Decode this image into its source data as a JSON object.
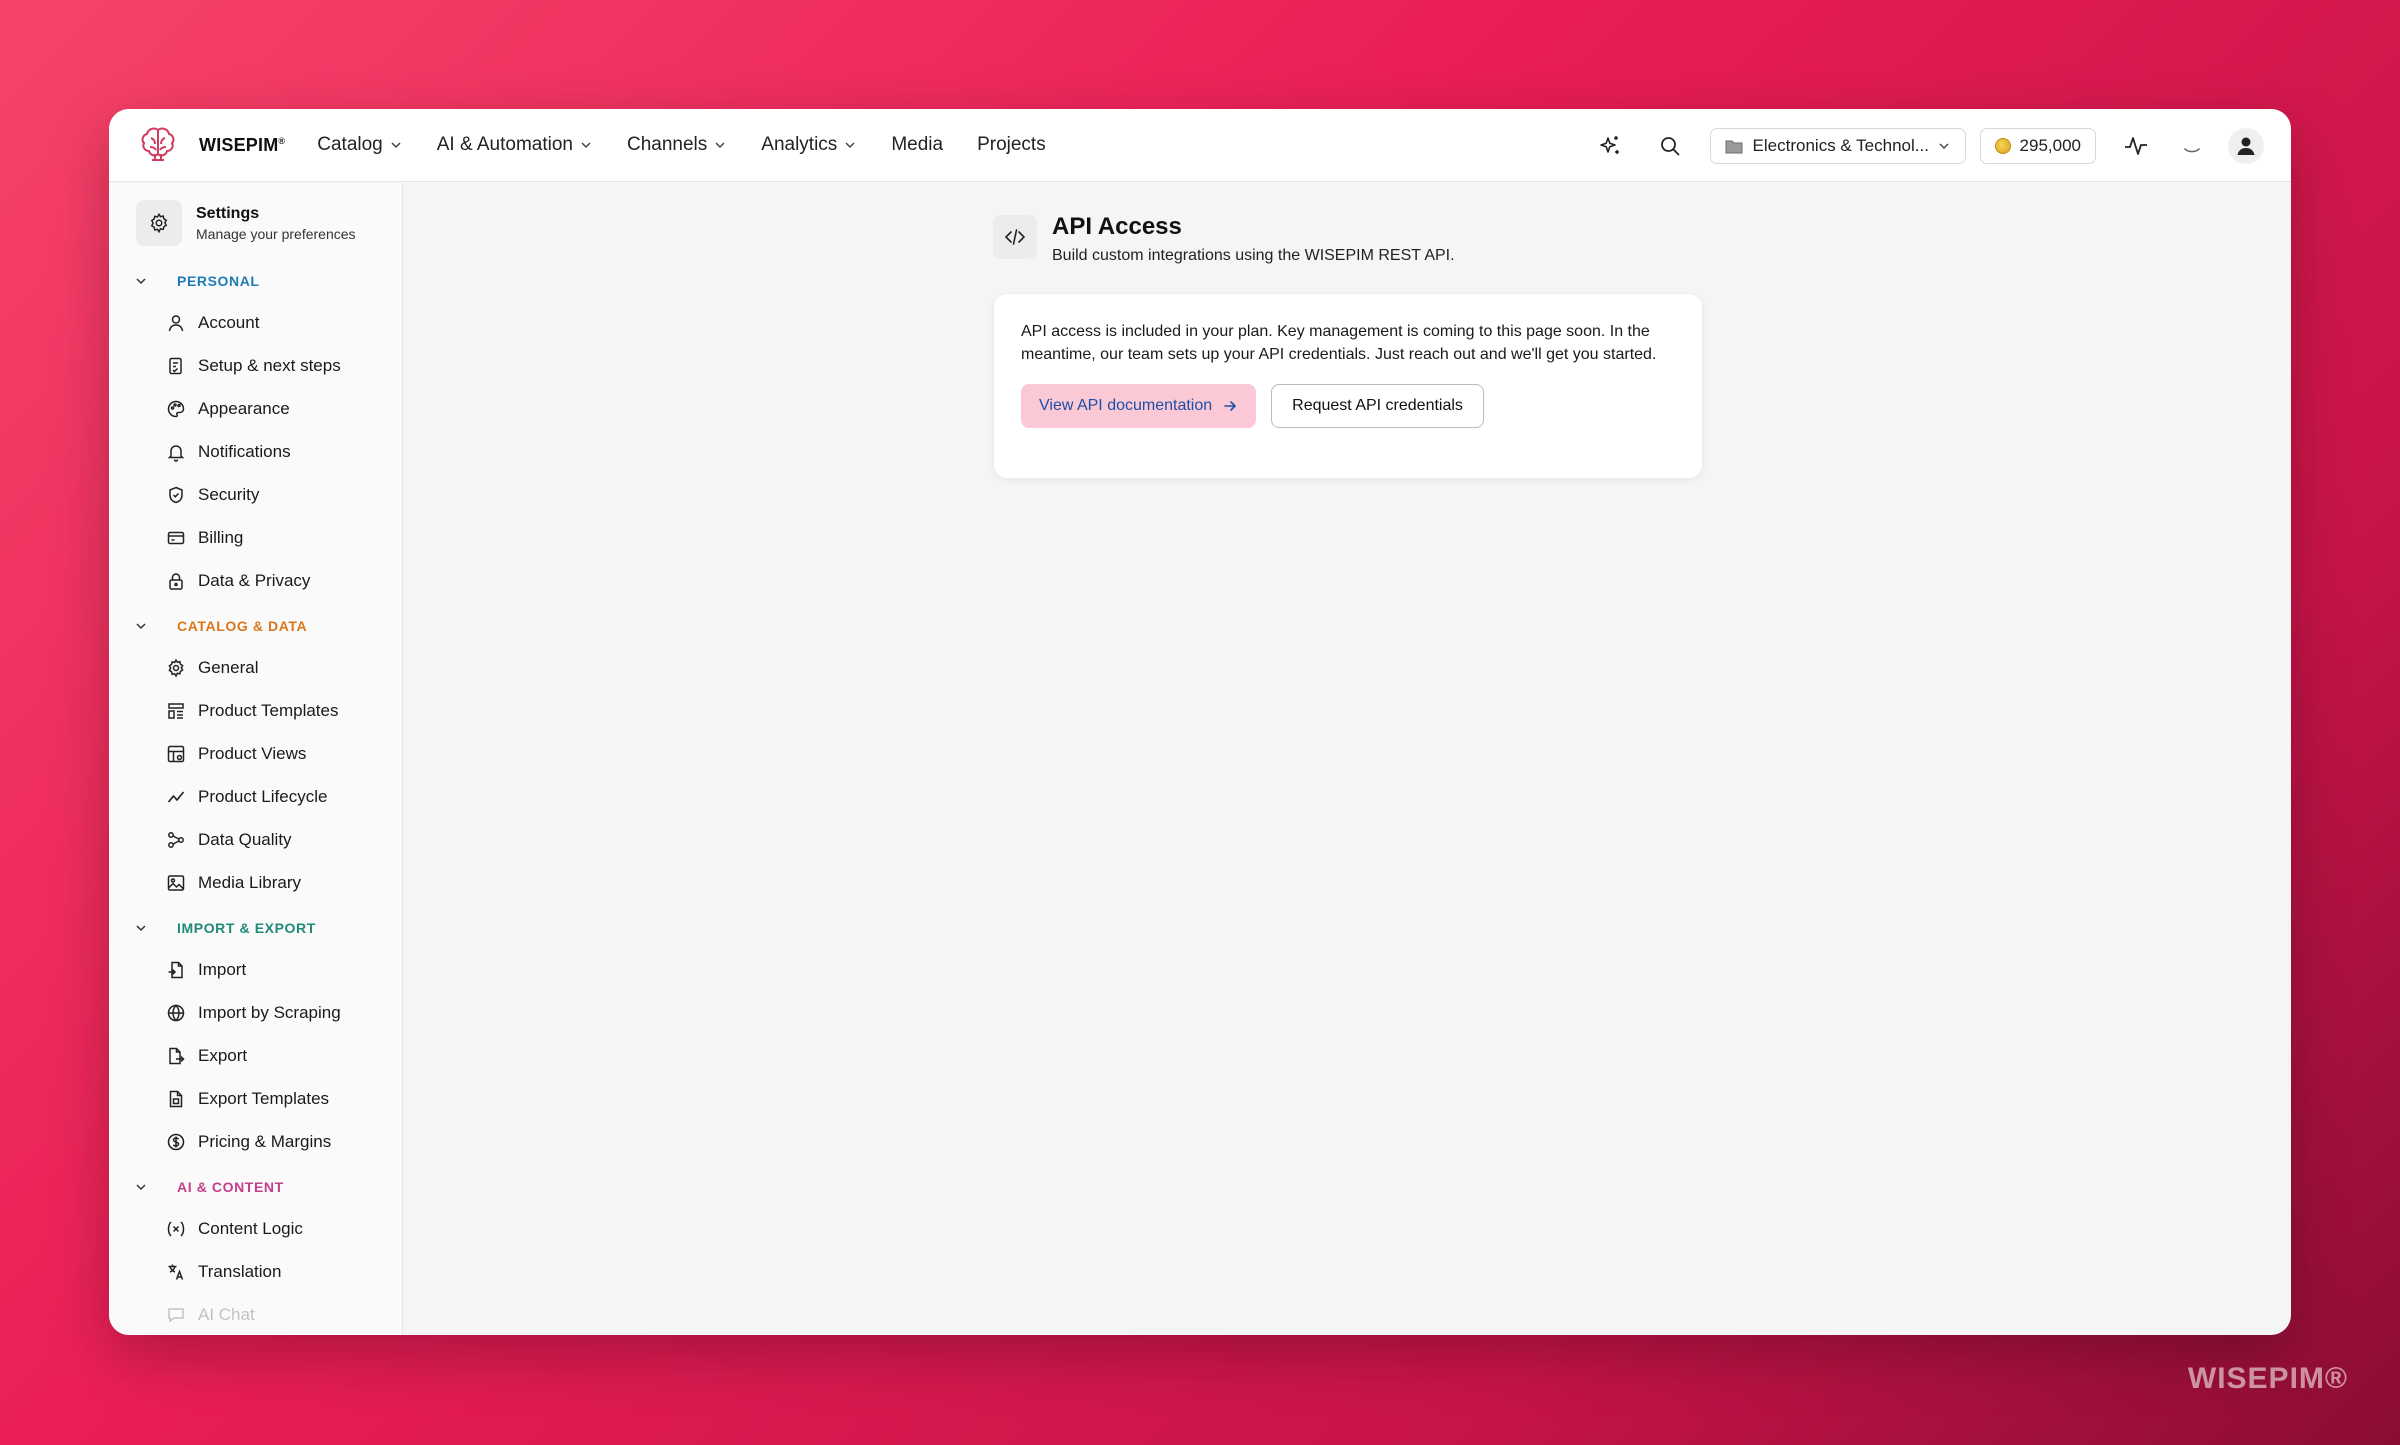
{
  "brand": {
    "name": "WISEPIM",
    "mark": "®"
  },
  "nav": [
    {
      "label": "Catalog",
      "dropdown": true
    },
    {
      "label": "AI & Automation",
      "dropdown": true
    },
    {
      "label": "Channels",
      "dropdown": true
    },
    {
      "label": "Analytics",
      "dropdown": true
    },
    {
      "label": "Media",
      "dropdown": false
    },
    {
      "label": "Projects",
      "dropdown": false
    }
  ],
  "toolbar": {
    "workspace": "Electronics & Technol...",
    "credits": "295,000"
  },
  "settings": {
    "title": "Settings",
    "subtitle": "Manage your preferences"
  },
  "sections": [
    {
      "title": "PERSONAL",
      "color": "#1f7bb6",
      "items": [
        {
          "label": "Account",
          "icon": "user-icon"
        },
        {
          "label": "Setup & next steps",
          "icon": "checklist-icon"
        },
        {
          "label": "Appearance",
          "icon": "palette-icon"
        },
        {
          "label": "Notifications",
          "icon": "bell-icon"
        },
        {
          "label": "Security",
          "icon": "shield-icon"
        },
        {
          "label": "Billing",
          "icon": "credit-card-icon"
        },
        {
          "label": "Data & Privacy",
          "icon": "lock-icon"
        }
      ]
    },
    {
      "title": "CATALOG & DATA",
      "color": "#d9771a",
      "items": [
        {
          "label": "General",
          "icon": "gear-icon"
        },
        {
          "label": "Product Templates",
          "icon": "template-icon"
        },
        {
          "label": "Product Views",
          "icon": "table-icon"
        },
        {
          "label": "Product Lifecycle",
          "icon": "trend-icon"
        },
        {
          "label": "Data Quality",
          "icon": "workflow-icon"
        },
        {
          "label": "Media Library",
          "icon": "image-icon"
        }
      ]
    },
    {
      "title": "IMPORT & EXPORT",
      "color": "#1f8a7a",
      "items": [
        {
          "label": "Import",
          "icon": "file-import-icon"
        },
        {
          "label": "Import by Scraping",
          "icon": "globe-icon"
        },
        {
          "label": "Export",
          "icon": "file-export-icon"
        },
        {
          "label": "Export Templates",
          "icon": "file-template-icon"
        },
        {
          "label": "Pricing & Margins",
          "icon": "dollar-icon"
        }
      ]
    },
    {
      "title": "AI & CONTENT",
      "color": "#c2408f",
      "items": [
        {
          "label": "Content Logic",
          "icon": "variable-icon"
        },
        {
          "label": "Translation",
          "icon": "translate-icon"
        },
        {
          "label": "AI Chat",
          "icon": "chat-icon"
        }
      ]
    }
  ],
  "page": {
    "title": "API Access",
    "subtitle": "Build custom integrations using the WISEPIM REST API.",
    "body": "API access is included in your plan. Key management is coming to this page soon. In the meantime, our team sets up your API credentials. Just reach out and we'll get you started.",
    "primary_button": "View API documentation",
    "secondary_button": "Request API credentials"
  },
  "watermark": "WISEPIM®"
}
